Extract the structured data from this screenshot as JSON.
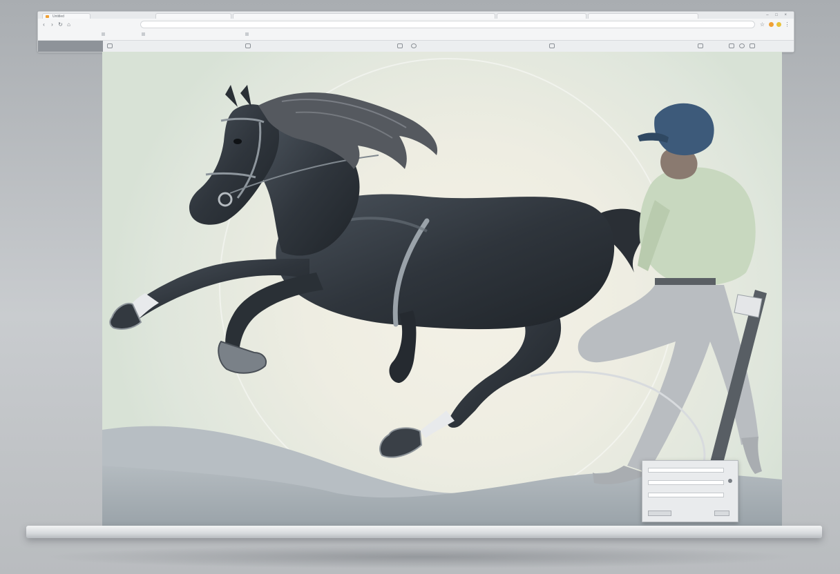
{
  "browser": {
    "tabs": [
      {
        "label": "Untitled"
      },
      {
        "label": ""
      },
      {
        "label": ""
      },
      {
        "label": ""
      },
      {
        "label": ""
      }
    ],
    "address": "",
    "window_controls": "– □ ×"
  },
  "illustration": {
    "subject": "horse-and-rider",
    "colors": {
      "background": "#eeede2",
      "horse": "#2f353c",
      "mane": "#4d5157",
      "helmet": "#3d5a7a",
      "shirt": "#c8d8bf",
      "trousers": "#b9bdc1",
      "hills": "#a7afb5"
    }
  },
  "icons": [
    "back-arrow-icon",
    "forward-arrow-icon",
    "reload-icon",
    "home-icon",
    "star-icon",
    "extension-icon",
    "menu-icon"
  ]
}
